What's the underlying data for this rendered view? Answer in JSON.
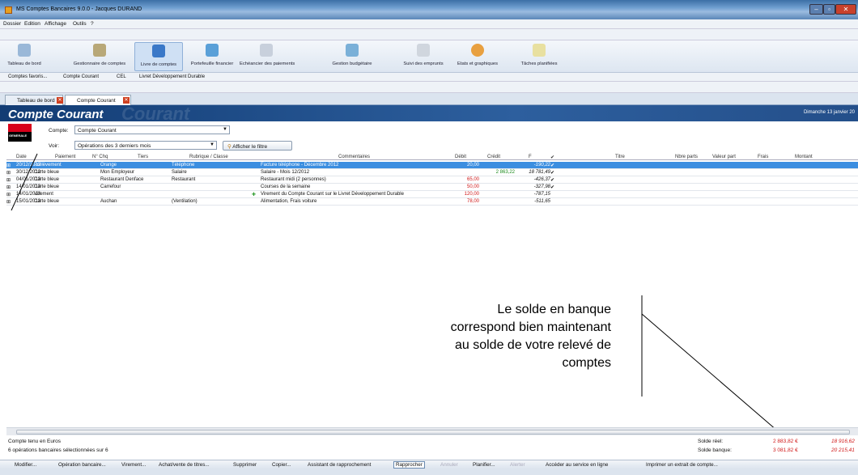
{
  "window": {
    "title": "MS Comptes Bancaires 9.0.0 - Jacques DURAND"
  },
  "menu": [
    "Dossier",
    "Edition",
    "Affichage",
    "Outils",
    "?"
  ],
  "toolbar_big": [
    {
      "label": "Tableau de bord",
      "icon": "dashboard-icon"
    },
    {
      "label": "Gestionnaire de comptes",
      "icon": "bank-icon"
    },
    {
      "label": "Livre de comptes",
      "icon": "book-icon",
      "selected": true
    },
    {
      "label": "Portefeuille financier",
      "icon": "portfolio-icon"
    },
    {
      "label": "Echéancier des paiements",
      "icon": "calendar-icon"
    },
    {
      "label": "Gestion budgétaire",
      "icon": "budget-icon"
    },
    {
      "label": "Suivi des emprunts",
      "icon": "loan-icon"
    },
    {
      "label": "Etats et graphiques",
      "icon": "chart-icon"
    },
    {
      "label": "Tâches planifiées",
      "icon": "tasks-icon"
    }
  ],
  "favorites": [
    "Comptes favoris...",
    "Compte Courant",
    "CEL",
    "Livret Développement Durable"
  ],
  "tabs": [
    {
      "label": "Tableau de bord"
    },
    {
      "label": "Compte Courant",
      "active": true
    }
  ],
  "header": {
    "title": "Compte Courant",
    "watermark": "Courant",
    "date": "Dimanche 13 janvier 20"
  },
  "form": {
    "compte_label": "Compte:",
    "compte_value": "Compte Courant",
    "voir_label": "Voir:",
    "voir_value": "Opérations des 3 derniers mois",
    "filter_btn": "Afficher le filtre",
    "bank_logo_text": "GENERALE"
  },
  "table": {
    "columns": [
      "Date",
      "Paiement",
      "N° Chq",
      "Tiers",
      "Rubrique / Classe",
      "Commentaires",
      "Débit",
      "Crédit",
      "F",
      "✔",
      "Titre",
      "Nbre parts",
      "Valeur part",
      "Frais",
      "Montant"
    ],
    "rows": [
      {
        "date": "20/12/2012",
        "paiement": "Prélèvement",
        "tiers": "Orange",
        "rubrique": "Téléphone",
        "commentaire": "Facture téléphone - Décembre 2012",
        "debit": "20,00",
        "credit": "",
        "solde": "-190,22",
        "check": "✔",
        "selected": true
      },
      {
        "date": "30/12/2012",
        "paiement": "Carte bleue",
        "tiers": "Mon Employeur",
        "rubrique": "Salaire",
        "commentaire": "Salaire - Mois 12/2012",
        "debit": "",
        "credit": "2 863,22",
        "solde": "18 781,49",
        "check": "✔"
      },
      {
        "date": "04/01/2013",
        "paiement": "Carte bleue",
        "tiers": "Restaurant Denface",
        "rubrique": "Restaurant",
        "commentaire": "Restaurant midi (2 personnes)",
        "debit": "65,00",
        "credit": "",
        "solde": "-426,37",
        "check": "✔"
      },
      {
        "date": "14/01/2013",
        "paiement": "Carte bleue",
        "tiers": "Carrefour",
        "rubrique": "",
        "commentaire": "Courses de la semaine",
        "debit": "50,00",
        "credit": "",
        "solde": "-327,98",
        "check": "✔"
      },
      {
        "date": "14/01/2013",
        "paiement": "Virement",
        "tiers": "",
        "rubrique": "",
        "commentaire": "Virement du Compte Courant sur le Livret Développement Durable",
        "debit": "120,00",
        "credit": "",
        "solde": "-787,15",
        "check": ""
      },
      {
        "date": "15/01/2013",
        "paiement": "Carte bleue",
        "tiers": "Auchan",
        "rubrique": "(Ventilation)",
        "commentaire": "Alimentation, Frais voiture",
        "debit": "78,00",
        "credit": "",
        "solde": "-511,65",
        "check": ""
      }
    ]
  },
  "status": {
    "currency": "Compte tenu en  Euros",
    "selection": "6 opérations bancaires sélectionnées sur 6",
    "solde_reel_label": "Solde réel:",
    "solde_reel_value": "2 883,82 €",
    "solde_reel_value2": "18 916,62",
    "solde_banque_label": "Solde banque:",
    "solde_banque_value": "3 081,82 €",
    "solde_banque_value2": "20 215,41"
  },
  "bottom_toolbar": [
    "Modifier...",
    "Opération bancaire...",
    "Virement...",
    "Achat/vente de titres...",
    "Supprimer",
    "Copier...",
    "Assistant de rapprochement",
    "Rapprocher",
    "Annuler",
    "Planifier...",
    "Alerter",
    "Accéder au service en ligne",
    "Imprimer un extrait de compte..."
  ],
  "annotation": [
    "Le solde en banque",
    "correspond bien maintenant",
    "au solde de votre relevé de",
    "comptes"
  ]
}
